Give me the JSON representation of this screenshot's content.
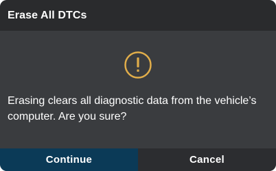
{
  "dialog": {
    "title": "Erase All DTCs",
    "icon": "warning-circle-icon",
    "message": "Erasing clears all diagnostic data from the vehicle’s computer. Are you sure?",
    "buttons": {
      "continue_label": "Continue",
      "cancel_label": "Cancel"
    },
    "colors": {
      "accent": "#e0ad4a",
      "primary_button": "#0b3a57",
      "secondary_button": "#2c2d30"
    }
  }
}
